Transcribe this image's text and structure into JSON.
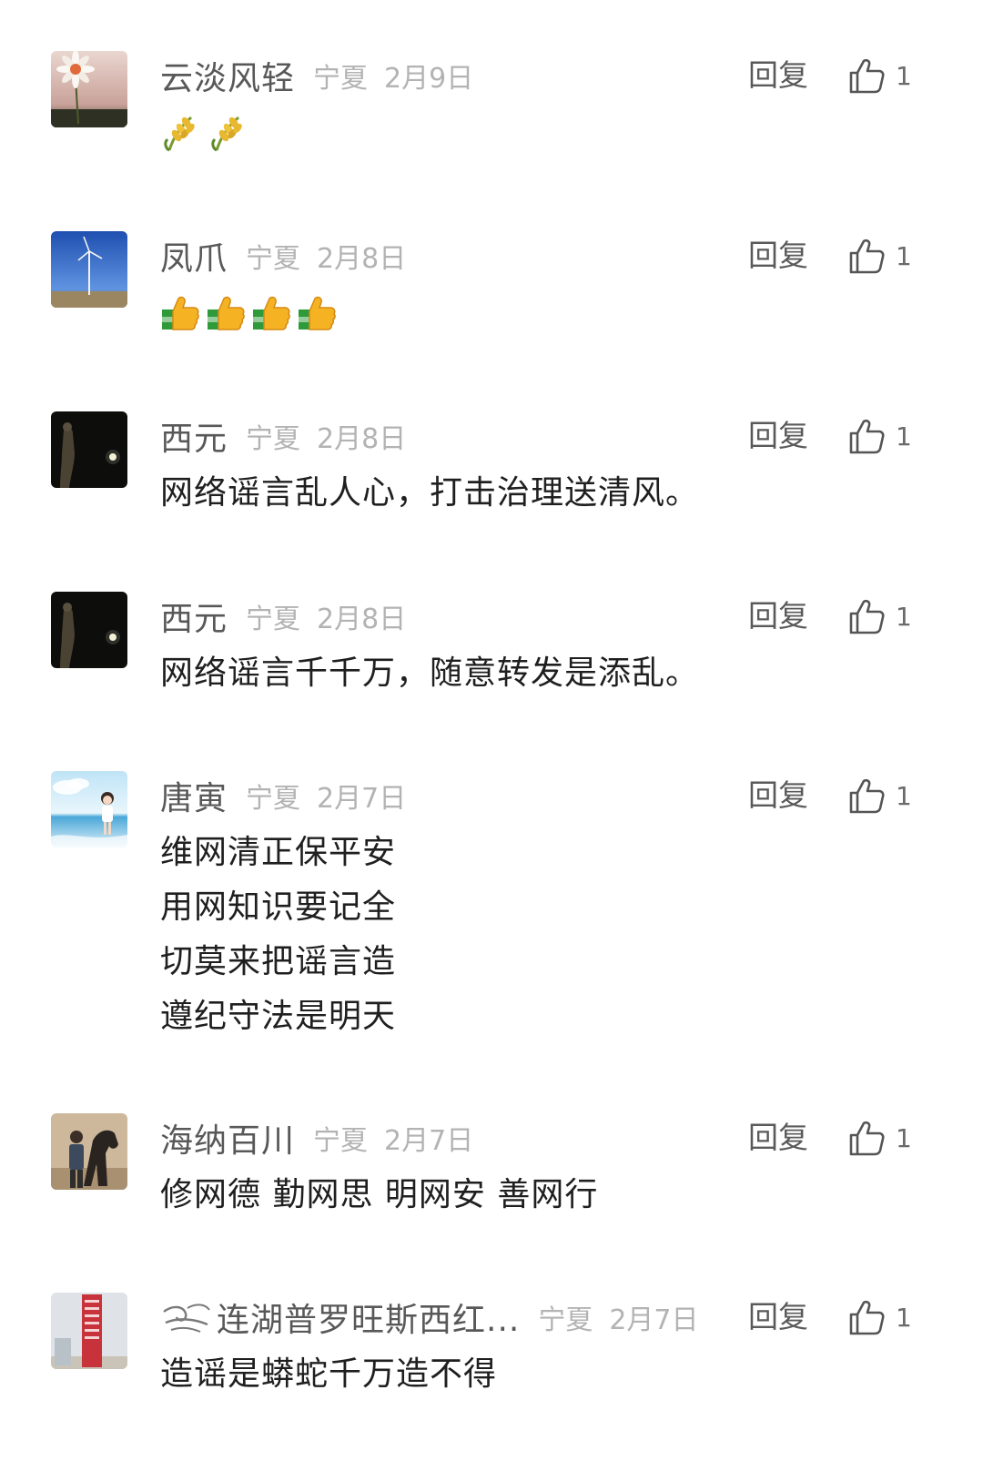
{
  "comments": [
    {
      "user": "云淡风轻",
      "region": "宁夏",
      "date": "2月9日",
      "reply_label": "回复",
      "likes": "1",
      "avatar": "daisy-flower-avatar",
      "emojis": [
        "rice-ear-emoji",
        "rice-ear-emoji"
      ]
    },
    {
      "user": "凤爪",
      "region": "宁夏",
      "date": "2月8日",
      "reply_label": "回复",
      "likes": "1",
      "avatar": "wind-turbine-sky-avatar",
      "emojis": [
        "thumbs-up-emoji",
        "thumbs-up-emoji",
        "thumbs-up-emoji",
        "thumbs-up-emoji"
      ]
    },
    {
      "user": "西元",
      "region": "宁夏",
      "date": "2月8日",
      "reply_label": "回复",
      "likes": "1",
      "avatar": "night-moon-figure-avatar",
      "lines": [
        "网络谣言乱人心，打击治理送清风。"
      ]
    },
    {
      "user": "西元",
      "region": "宁夏",
      "date": "2月8日",
      "reply_label": "回复",
      "likes": "1",
      "avatar": "night-moon-figure-avatar",
      "lines": [
        "网络谣言千千万，随意转发是添乱。"
      ]
    },
    {
      "user": "唐寅",
      "region": "宁夏",
      "date": "2月7日",
      "reply_label": "回复",
      "likes": "1",
      "avatar": "child-beach-avatar",
      "lines": [
        "维网清正保平安",
        "用网知识要记全",
        "切莫来把谣言造",
        "遵纪守法是明天"
      ]
    },
    {
      "user": "海纳百川",
      "region": "宁夏",
      "date": "2月7日",
      "reply_label": "回复",
      "likes": "1",
      "avatar": "man-with-horse-avatar",
      "lines": [
        "修网德 勤网思 明网安 善网行"
      ]
    },
    {
      "user": "连湖普罗旺斯西红...",
      "name_prefix_icon": "swirl-wind-icon",
      "region": "宁夏",
      "date": "2月7日",
      "reply_label": "回复",
      "likes": "1",
      "avatar": "red-banner-building-avatar",
      "lines": [
        "造谣是蟒蛇千万造不得"
      ]
    }
  ],
  "colors": {
    "name": "#585858",
    "meta": "#b3b3b3",
    "text": "#1f1f1f",
    "action": "#5a5a5a"
  }
}
